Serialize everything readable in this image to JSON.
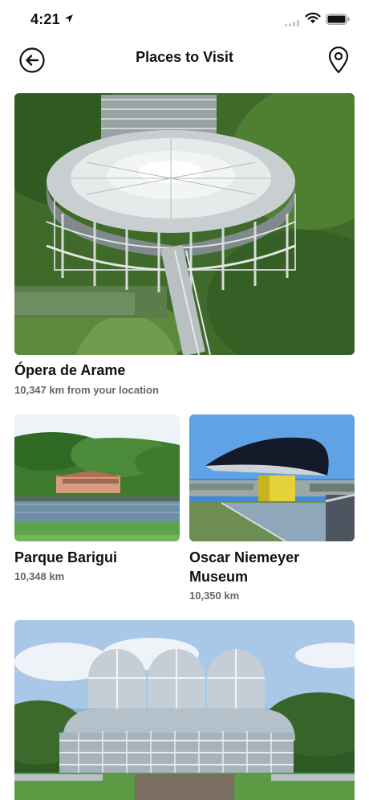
{
  "status_bar": {
    "time": "4:21"
  },
  "header": {
    "title": "Places to Visit"
  },
  "places": [
    {
      "name": "Ópera de Arame",
      "distance": "10,347 km from your location"
    },
    {
      "name": "Parque Barigui",
      "distance": "10,348 km"
    },
    {
      "name": "Oscar Niemeyer Museum",
      "distance": "10,350 km"
    },
    {
      "name": "",
      "distance": ""
    }
  ],
  "icons": {
    "back": "arrow-left-circle-icon",
    "map": "map-pin-icon",
    "location": "location-arrow-icon",
    "wifi": "wifi-icon",
    "battery": "battery-icon",
    "signal": "cellular-signal-icon"
  }
}
